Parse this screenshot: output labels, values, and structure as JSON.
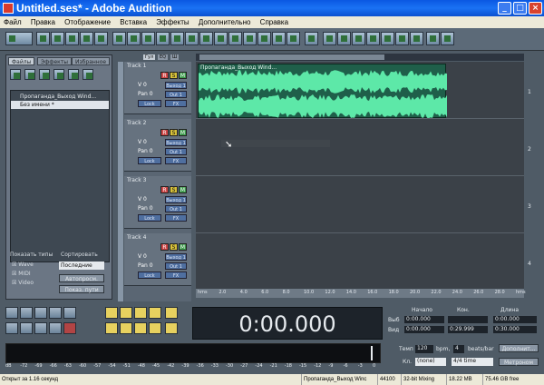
{
  "window": {
    "title": "Untitled.ses* - Adobe Audition"
  },
  "menu": [
    "Файл",
    "Правка",
    "Отображение",
    "Вставка",
    "Эффекты",
    "Дополнительно",
    "Справка"
  ],
  "left_panel": {
    "tabs": [
      "Файлы",
      "Эффекты",
      "Избранное"
    ],
    "files": [
      "Пропаганда_Выход Wind...",
      "Без имени *"
    ],
    "show_types_label": "Показать типы",
    "types": [
      "Wave",
      "MIDI",
      "Video"
    ],
    "sort_label": "Сортировать",
    "sort_value": "Последние",
    "autoplay_label": "Автопросм.",
    "paths_label": "Показ. пути"
  },
  "view_tabs": [
    "Гул",
    "EQ",
    "Ш"
  ],
  "tracks": [
    {
      "name": "Track 1",
      "vol": "V 0",
      "pan": "Pan 0",
      "out": "Out 1",
      "in": "Выход 1",
      "lock": "Lock",
      "fx": "FX",
      "num": "1"
    },
    {
      "name": "Track 2",
      "vol": "V 0",
      "pan": "Pan 0",
      "out": "Out 1",
      "in": "Выход 1",
      "lock": "Lock",
      "fx": "FX",
      "num": "2"
    },
    {
      "name": "Track 3",
      "vol": "V 0",
      "pan": "Pan 0",
      "out": "Out 1",
      "in": "Выход 1",
      "lock": "Lock",
      "fx": "FX",
      "num": "3"
    },
    {
      "name": "Track 4",
      "vol": "V 0",
      "pan": "Pan 0",
      "out": "Out 1",
      "in": "Выход 1",
      "lock": "Lock",
      "fx": "FX",
      "num": "4"
    }
  ],
  "clip": {
    "label": "Пропаганда_Выход Wind..."
  },
  "ruler": [
    "hms",
    "2.0",
    "4.0",
    "6.0",
    "8.0",
    "10.0",
    "12.0",
    "14.0",
    "16.0",
    "18.0",
    "20.0",
    "22.0",
    "24.0",
    "26.0",
    "28.0",
    "hms"
  ],
  "time": "0:00.000",
  "info": {
    "headers": [
      "Начало",
      "Кон.",
      "Длина"
    ],
    "rows": [
      {
        "label": "Выб",
        "start": "0:00.000",
        "end": "",
        "len": "0:00.000"
      },
      {
        "label": "Вид",
        "start": "0:00.000",
        "end": "0:29.999",
        "len": "0:30.000"
      }
    ]
  },
  "meter_scale": [
    "dB",
    "-72",
    "-69",
    "-66",
    "-63",
    "-60",
    "-57",
    "-54",
    "-51",
    "-48",
    "-45",
    "-42",
    "-39",
    "-36",
    "-33",
    "-30",
    "-27",
    "-24",
    "-21",
    "-18",
    "-15",
    "-12",
    "-9",
    "-6",
    "-3",
    "0"
  ],
  "bottom": {
    "tempo_label": "Темп",
    "tempo": "120",
    "bpm": "bpm,",
    "beats": "4",
    "beats_label": "beats/bar",
    "more": "Дополнит...",
    "key_label": "Кл.",
    "key": "(none)",
    "time_sig": "4/4 time",
    "metronome": "Метроном"
  },
  "status": [
    "Открыт за 1.16 секунд",
    "Пропаганда_Выход Winc",
    "44100",
    "32-bit Mixing",
    "18.22 MB",
    "75.46 GB free"
  ],
  "colors": {
    "wave": "#5de8a8",
    "clip_bg": "#1f5f4a",
    "panel": "#5a6673"
  }
}
